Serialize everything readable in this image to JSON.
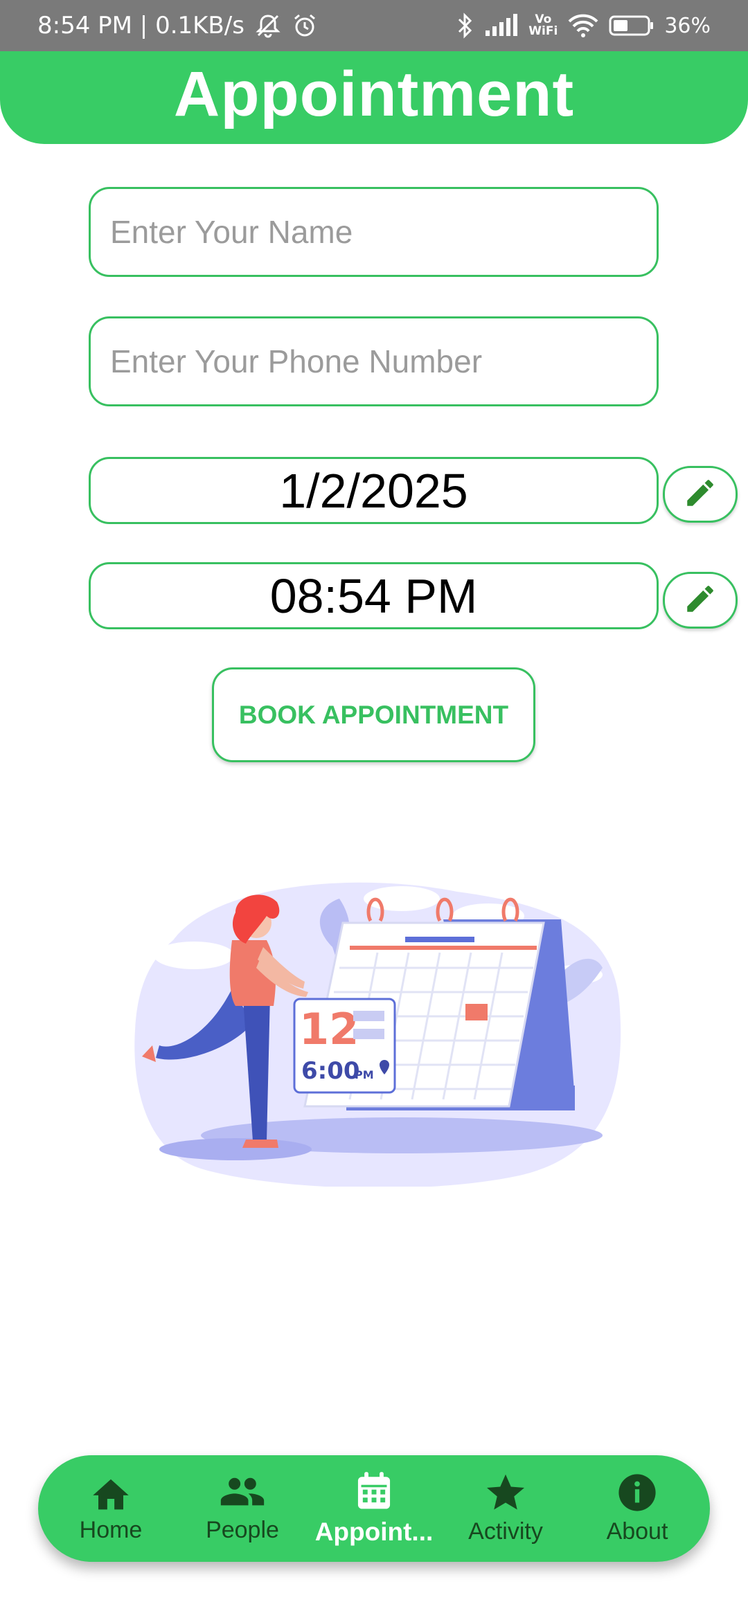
{
  "status_bar": {
    "time_speed": "8:54 PM | 0.1KB/s",
    "volte_line1": "Vo",
    "volte_line2": "WiFi",
    "battery": "36%"
  },
  "header": {
    "title": "Appointment"
  },
  "form": {
    "name_placeholder": "Enter Your Name",
    "phone_placeholder": "Enter Your Phone Number",
    "date_value": "1/2/2025",
    "time_value": "08:54 PM",
    "book_label": "BOOK APPOINTMENT"
  },
  "illustration": {
    "calendar_day": "12",
    "calendar_time": "6:00",
    "calendar_ampm": "PM"
  },
  "nav": {
    "items": [
      {
        "label": "Home",
        "icon": "home-icon"
      },
      {
        "label": "People",
        "icon": "people-icon"
      },
      {
        "label": "Appoint...",
        "icon": "calendar-icon"
      },
      {
        "label": "Activity",
        "icon": "star-icon"
      },
      {
        "label": "About",
        "icon": "info-icon"
      }
    ],
    "active_index": 2
  },
  "colors": {
    "primary_green": "#38cc65",
    "border_green": "#38c060",
    "dark_green_icon": "#17481f",
    "edit_icon_green": "#2e8b2e"
  }
}
